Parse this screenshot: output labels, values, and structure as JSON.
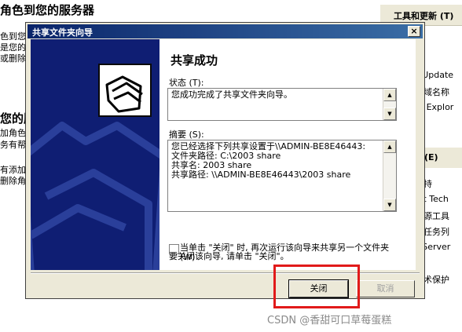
{
  "background": {
    "left_lines": [
      {
        "text": "角色到您的服务器",
        "kind": "heading"
      },
      {
        "text": "色到您的",
        "kind": "text"
      },
      {
        "text": "是您的",
        "kind": "text"
      },
      {
        "text": "或删除角",
        "kind": "text"
      },
      {
        "text": "您的服",
        "kind": "heading"
      },
      {
        "text": "加角色,",
        "kind": "text"
      },
      {
        "text": "务有帮",
        "kind": "text"
      },
      {
        "text": "有添加",
        "kind": "text"
      },
      {
        "text": "删除角",
        "kind": "text"
      }
    ],
    "right_panel": {
      "title": "工具和更新 (T)",
      "items": [
        "具",
        "具",
        "s Update",
        "和域名称",
        "et Explor"
      ],
      "title2": "(E)",
      "items2": [
        "支持",
        "oft Tech",
        "资源工具",
        "理任务列",
        "s Server",
        "技术保护"
      ]
    },
    "watermark": "CSDN @香甜可口草莓蛋糕"
  },
  "dialog": {
    "title": "共享文件夹向导",
    "close_glyph": "×",
    "heading": "共享成功",
    "status_label": "状态 (T):",
    "status_text": "您成功完成了共享文件夹向导。",
    "summary_label": "摘要 (S):",
    "summary_lines": [
      "您已经选择下列共享设置于\\\\ADMIN-BE8E46443:",
      "文件夹路径: C:\\2003 share",
      "共享名: 2003 share",
      "共享路径: \\\\ADMIN-BE8E46443\\2003 share"
    ],
    "checkbox_label": "当单击 \"关闭\" 时, 再次运行该向导来共享另一个文件夹 (W)",
    "checkbox_checked": false,
    "close_hint": "要关闭该向导, 请单击 \"关闭\"。",
    "close_button": "关闭",
    "cancel_button": "取消"
  }
}
